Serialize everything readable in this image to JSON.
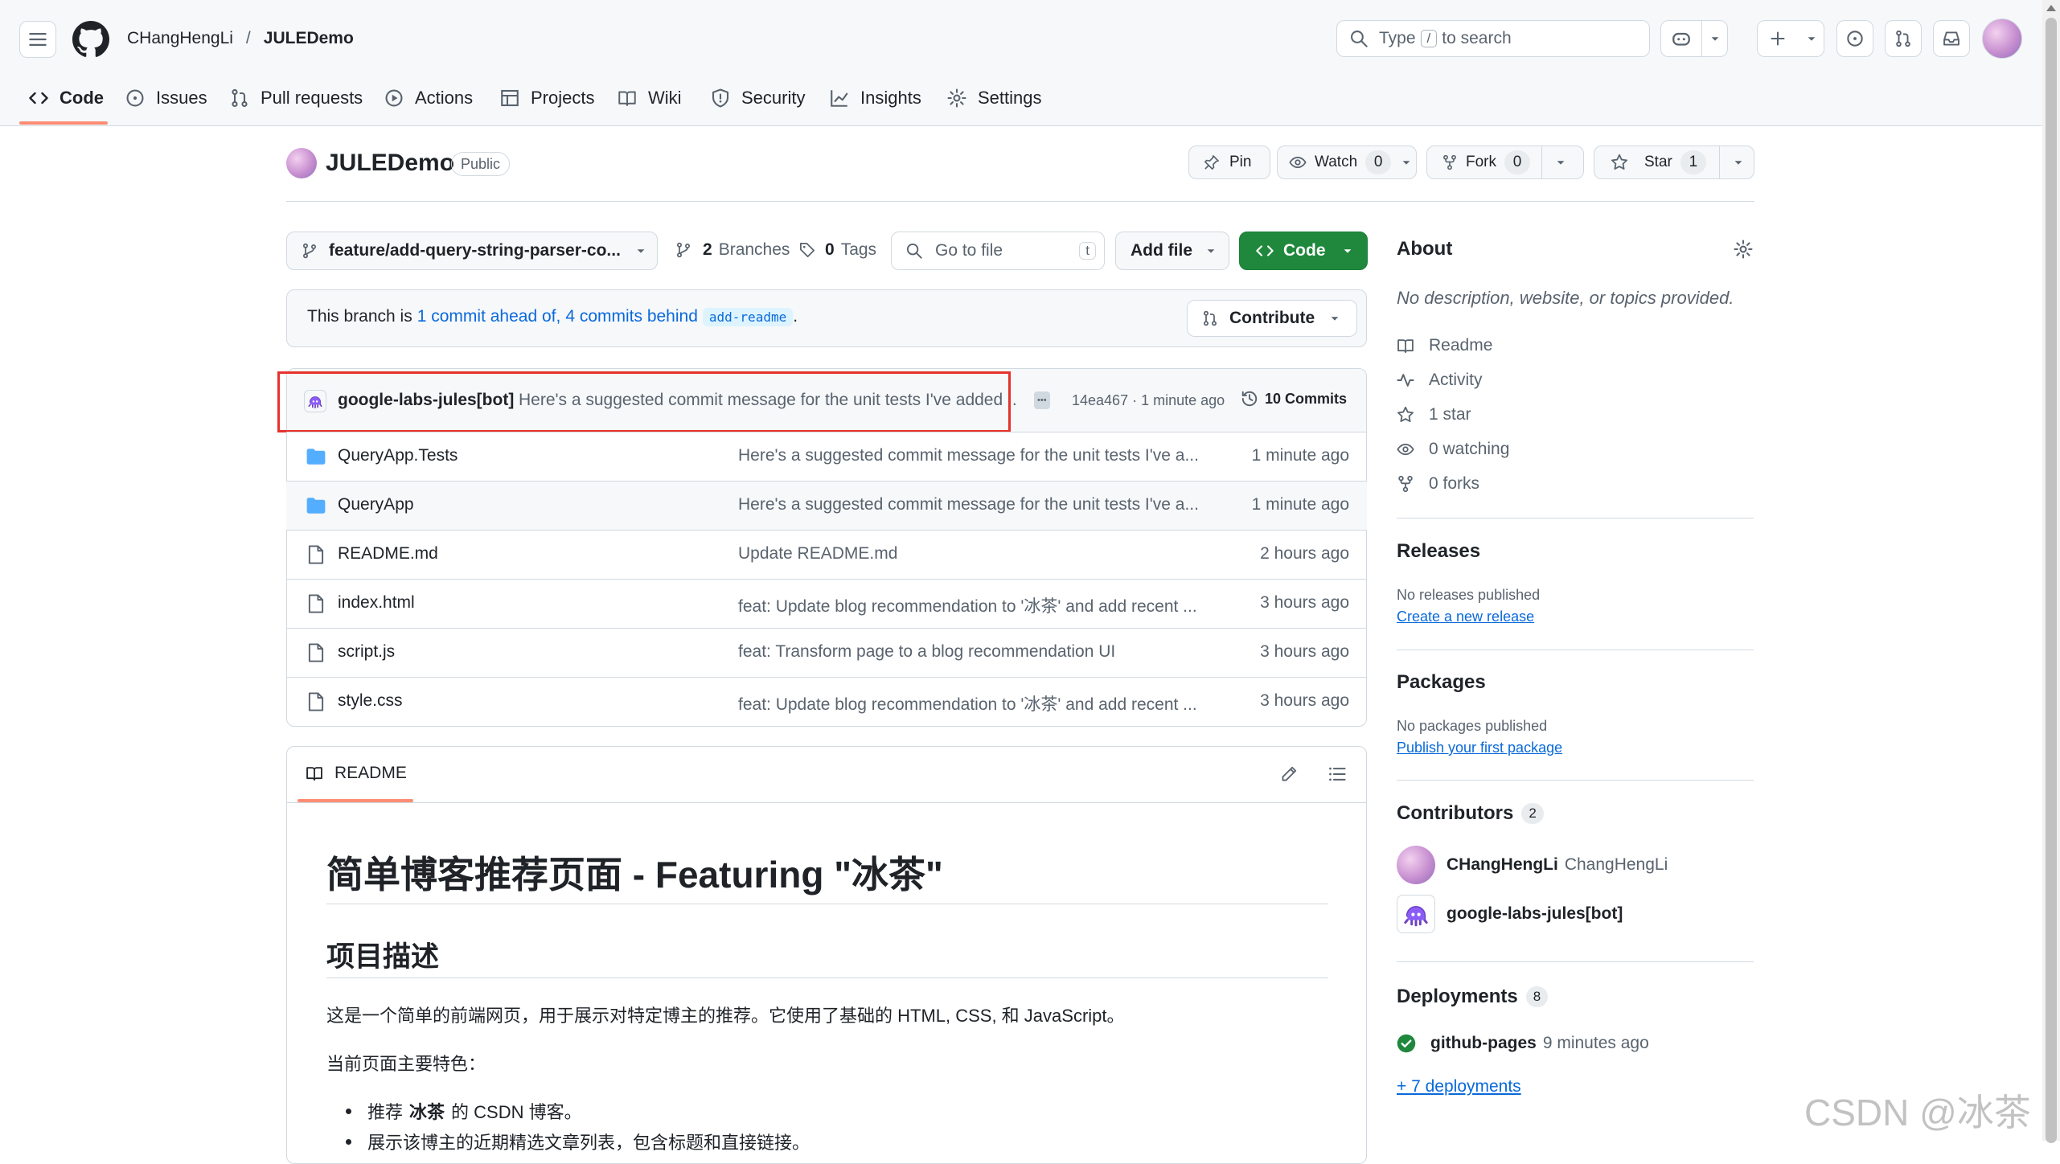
{
  "header": {
    "owner": "CHangHengLi",
    "separator": "/",
    "repo": "JULEDemo",
    "search_prefix": "Type",
    "search_key": "/",
    "search_suffix": "to search"
  },
  "tabs": [
    {
      "label": "Code",
      "icon": "code-icon",
      "active": true
    },
    {
      "label": "Issues",
      "icon": "issue-icon"
    },
    {
      "label": "Pull requests",
      "icon": "pull-request-icon"
    },
    {
      "label": "Actions",
      "icon": "play-icon"
    },
    {
      "label": "Projects",
      "icon": "table-icon"
    },
    {
      "label": "Wiki",
      "icon": "book-icon"
    },
    {
      "label": "Security",
      "icon": "shield-icon"
    },
    {
      "label": "Insights",
      "icon": "graph-icon"
    },
    {
      "label": "Settings",
      "icon": "gear-icon"
    }
  ],
  "repo_head": {
    "name": "JULEDemo",
    "visibility": "Public",
    "pin": "Pin",
    "watch": "Watch",
    "watch_count": "0",
    "fork": "Fork",
    "fork_count": "0",
    "star": "Star",
    "star_count": "1"
  },
  "toolbar": {
    "branch": "feature/add-query-string-parser-co...",
    "branches_count": "2",
    "branches_label": "Branches",
    "tags_count": "0",
    "tags_label": "Tags",
    "goto_placeholder": "Go to file",
    "goto_key": "t",
    "add_file": "Add file",
    "code": "Code"
  },
  "branch_status": {
    "prefix": "This branch is",
    "ahead": "1 commit ahead of,",
    "behind": "4 commits behind",
    "base": "add-readme",
    "suffix": ".",
    "contribute": "Contribute"
  },
  "latest_commit": {
    "author": "google-labs-jules[bot]",
    "message": "Here's a suggested commit message for the unit tests I've added ...",
    "more": "•••",
    "hash_time": "14ea467 · 1 minute ago",
    "commits": "10 Commits"
  },
  "files": [
    {
      "name": "QueryApp.Tests",
      "type": "dir",
      "message": "Here's a suggested commit message for the unit tests I've a...",
      "time": "1 minute ago"
    },
    {
      "name": "QueryApp",
      "type": "dir",
      "message": "Here's a suggested commit message for the unit tests I've a...",
      "time": "1 minute ago"
    },
    {
      "name": "README.md",
      "type": "file",
      "message": "Update README.md",
      "time": "2 hours ago"
    },
    {
      "name": "index.html",
      "type": "file",
      "message": "feat: Update blog recommendation to '冰茶' and add recent ...",
      "time": "3 hours ago"
    },
    {
      "name": "script.js",
      "type": "file",
      "message": "feat: Transform page to a blog recommendation UI",
      "time": "3 hours ago"
    },
    {
      "name": "style.css",
      "type": "file",
      "message": "feat: Update blog recommendation to '冰茶' and add recent ...",
      "time": "3 hours ago"
    }
  ],
  "readme": {
    "tab": "README",
    "h1": "简单博客推荐页面 - Featuring \"冰茶\"",
    "h2": "项目描述",
    "p1": "这是一个简单的前端网页，用于展示对特定博主的推荐。它使用了基础的 HTML, CSS, 和 JavaScript。",
    "p2": "当前页面主要特色：",
    "li1_prefix": "推荐",
    "li1_bold": "冰茶",
    "li1_suffix": "的 CSDN 博客。",
    "li2": "展示该博主的近期精选文章列表，包含标题和直接链接。"
  },
  "about": {
    "title": "About",
    "desc": "No description, website, or topics provided.",
    "readme": "Readme",
    "activity": "Activity",
    "stars": "1 star",
    "watching": "0 watching",
    "forks": "0 forks"
  },
  "releases": {
    "title": "Releases",
    "none": "No releases published",
    "create": "Create a new release"
  },
  "packages": {
    "title": "Packages",
    "none": "No packages published",
    "publish": "Publish your first package"
  },
  "contributors": {
    "title": "Contributors",
    "count": "2",
    "people": [
      {
        "name": "CHangHengLi",
        "login": "ChangHengLi"
      },
      {
        "name": "google-labs-jules[bot]",
        "login": ""
      }
    ]
  },
  "deployments": {
    "title": "Deployments",
    "count": "8",
    "env": "github-pages",
    "time": "9 minutes ago",
    "more": "+ 7 deployments"
  },
  "watermark": "CSDN @冰茶",
  "colors": {
    "accent": "#0969da",
    "green": "#1f883d",
    "highlight_box": "#e5322d",
    "folder": "#54aeff",
    "tab_underline": "#fd8c73"
  }
}
